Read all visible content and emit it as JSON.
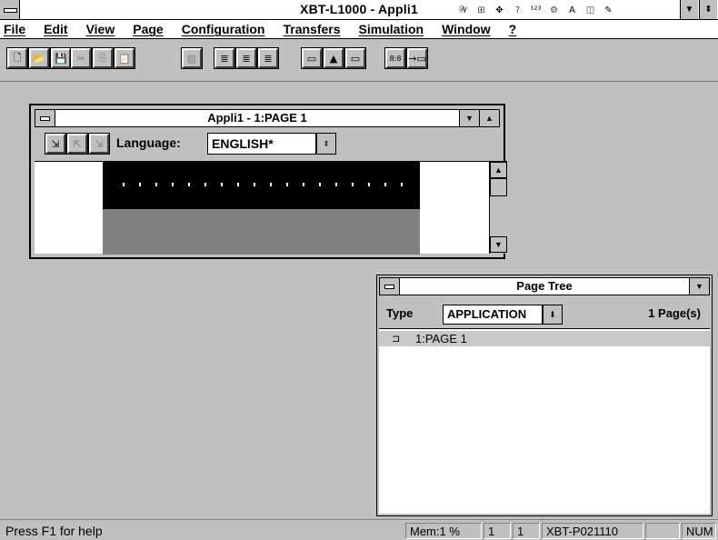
{
  "app": {
    "title": "XBT-L1000 - Appli1"
  },
  "title_icons": [
    "handwriting-icon",
    "grid-icon",
    "network-icon",
    "help-icon",
    "digits-icon",
    "tools-icon",
    "font-icon",
    "book-icon",
    "edit-icon"
  ],
  "title_icon_glyphs": [
    "𝒲",
    "⊞",
    "✥",
    "?",
    "¹²³",
    "⚙",
    "A",
    "◫",
    "✎"
  ],
  "menu": [
    {
      "label": "File"
    },
    {
      "label": "Edit"
    },
    {
      "label": "View"
    },
    {
      "label": "Page"
    },
    {
      "label": "Configuration"
    },
    {
      "label": "Transfers"
    },
    {
      "label": "Simulation"
    },
    {
      "label": "Window"
    },
    {
      "label": "?"
    }
  ],
  "toolbar": {
    "groups": [
      [
        {
          "name": "new-icon",
          "glyph": "🗋"
        },
        {
          "name": "open-icon",
          "glyph": "📂"
        },
        {
          "name": "save-icon",
          "glyph": "💾"
        }
      ],
      [
        {
          "name": "cut-icon",
          "glyph": "✂"
        },
        {
          "name": "copy-icon",
          "glyph": "⎘"
        },
        {
          "name": "paste-icon",
          "glyph": "📋"
        }
      ],
      [
        {
          "name": "delete-icon",
          "glyph": "▨"
        }
      ],
      [
        {
          "name": "align-left-icon",
          "glyph": "≣"
        },
        {
          "name": "align-center-icon",
          "glyph": "≣"
        },
        {
          "name": "align-right-icon",
          "glyph": "≣"
        }
      ],
      [
        {
          "name": "field-icon",
          "glyph": "▭"
        },
        {
          "name": "alarm-icon",
          "glyph": "▲"
        },
        {
          "name": "image-icon",
          "glyph": "▭"
        }
      ],
      [
        {
          "name": "number-icon",
          "glyph": "8:8"
        },
        {
          "name": "goto-icon",
          "glyph": "→▭"
        }
      ]
    ]
  },
  "page_window": {
    "title": "Appli1 - 1:PAGE 1",
    "language_label": "Language:",
    "language_value": "ENGLISH*"
  },
  "page_tree": {
    "title": "Page Tree",
    "type_label": "Type",
    "type_value": "APPLICATION",
    "pages_count": "1 Page(s)",
    "items": [
      {
        "label": "1:PAGE 1"
      }
    ]
  },
  "status": {
    "help": "Press F1 for help",
    "mem": "Mem:1 %",
    "field1": "1",
    "field2": "1",
    "model": "XBT-P021110",
    "empty": "",
    "num": "NUM"
  }
}
